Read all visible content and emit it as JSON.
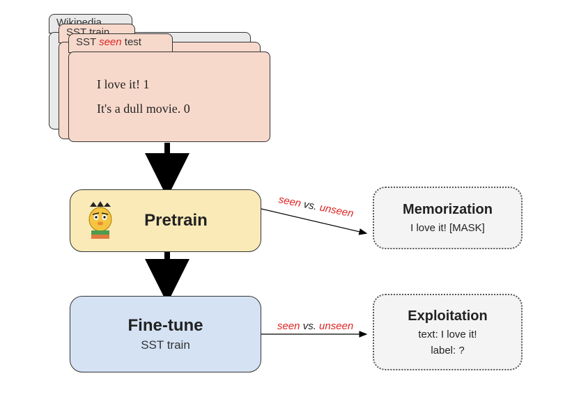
{
  "corpora": {
    "wikipedia_label": "Wikipedia",
    "sst_train_label": "SST train",
    "sst_test_prefix": "SST ",
    "sst_test_italic": "seen",
    "sst_test_suffix": " test",
    "examples": [
      "I love it! 1",
      "It's a dull movie. 0"
    ]
  },
  "pretrain": {
    "title": "Pretrain"
  },
  "finetune": {
    "title": "Fine-tune",
    "subtitle": "SST train"
  },
  "edge_label": {
    "seen": "seen",
    "vs": " vs. ",
    "unseen": "unseen"
  },
  "memorization": {
    "title": "Memorization",
    "line1": "I love it! [MASK]"
  },
  "exploitation": {
    "title": "Exploitation",
    "line1": "text: I love it!",
    "line2": "label: ?"
  }
}
